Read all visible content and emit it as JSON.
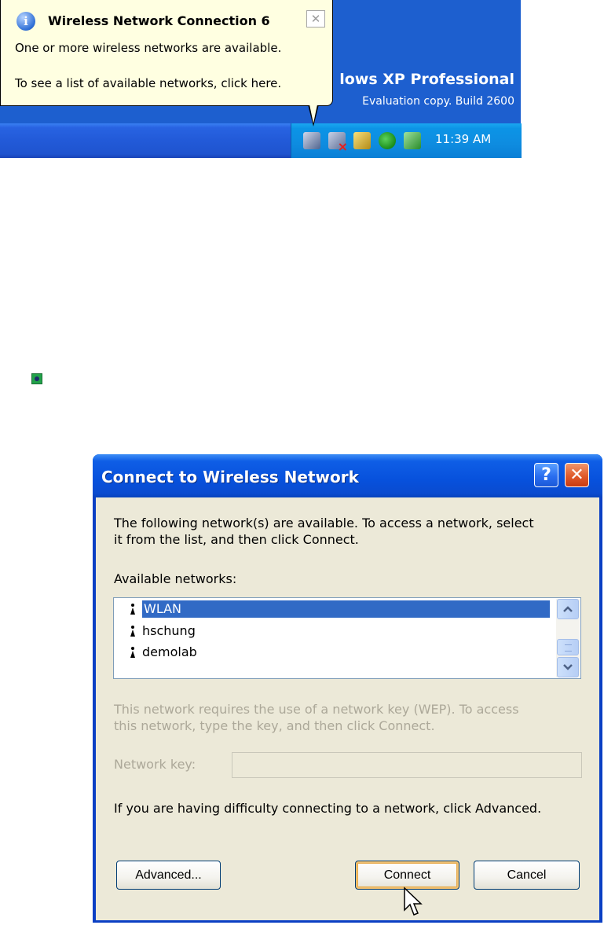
{
  "desktop": {
    "watermark_title": "lows XP Professional",
    "watermark_build": "Evaluation copy. Build 2600",
    "clock": "11:39 AM",
    "tray_icons": [
      "network-icon",
      "network-disconnected-icon",
      "keys-icon",
      "messenger-icon",
      "safely-remove-icon"
    ]
  },
  "balloon": {
    "title": "Wireless Network Connection 6",
    "close_glyph": "✕",
    "info_glyph": "i",
    "line1": "One or more wireless networks are available.",
    "line2": "To see a list of available networks, click here."
  },
  "dialog": {
    "title": "Connect to Wireless Network",
    "help_glyph": "?",
    "close_glyph": "✕",
    "intro_line1": "The following network(s) are available. To access a network, select",
    "intro_line2": "it from the list, and then click Connect.",
    "available_label": "Available networks:",
    "networks": [
      {
        "name": "WLAN",
        "selected": true
      },
      {
        "name": "hschung",
        "selected": false
      },
      {
        "name": "demolab",
        "selected": false
      }
    ],
    "wep_line1": "This network requires the use of a network key (WEP). To access",
    "wep_line2": "this network, type the key, and then click Connect.",
    "network_key_label": "Network key:",
    "network_key_value": "",
    "advanced_hint": "If you are having difficulty connecting to a network, click Advanced.",
    "buttons": {
      "advanced": "Advanced...",
      "connect": "Connect",
      "cancel": "Cancel"
    }
  },
  "colors": {
    "desktop_blue": "#1d5fcf",
    "titlebar_blue": "#0751dc",
    "selection_blue": "#316ac5",
    "dialog_face": "#ece9d8",
    "balloon_bg": "#ffffe1",
    "disabled_text": "#aca899"
  }
}
